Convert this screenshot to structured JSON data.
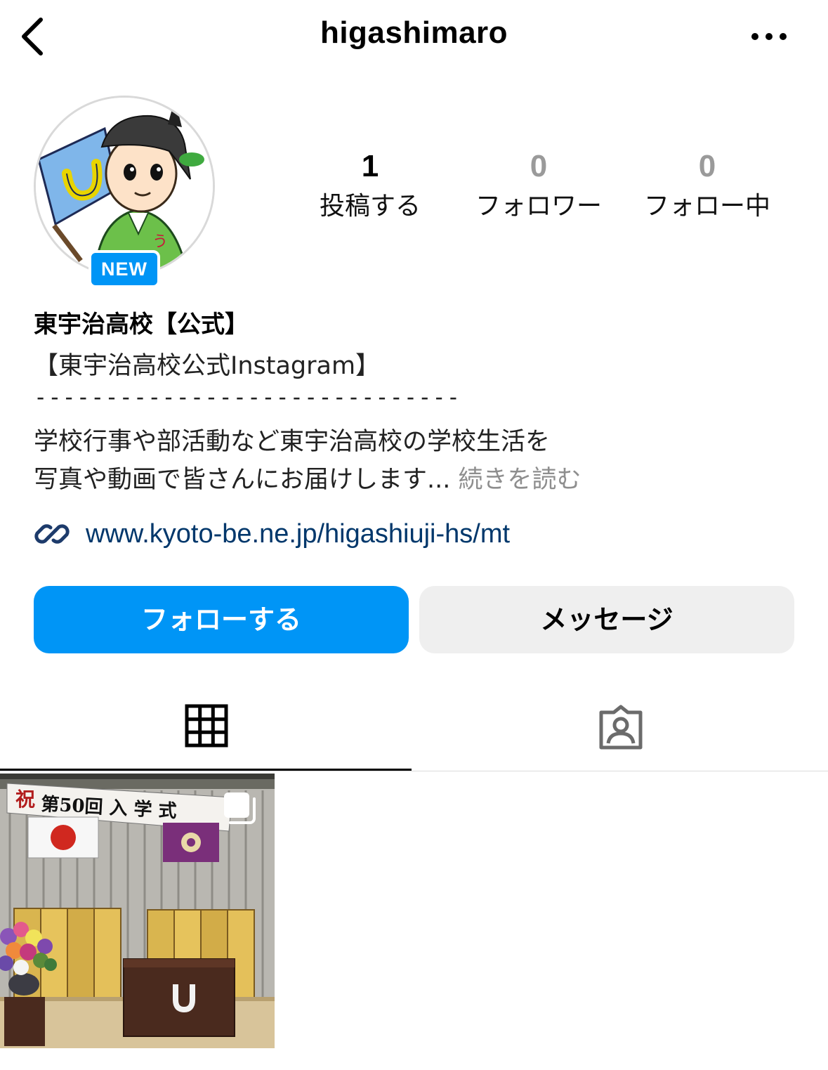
{
  "header": {
    "username": "higashimaro",
    "back_icon": "chevron-left-icon",
    "more_icon": "ellipsis-icon"
  },
  "profile": {
    "avatar_alt": "mascot-illustration",
    "new_badge": "NEW",
    "stats": [
      {
        "value": "1",
        "label": "投稿する"
      },
      {
        "value": "0",
        "label": "フォロワー"
      },
      {
        "value": "0",
        "label": "フォロー中"
      }
    ],
    "display_name": "東宇治高校【公式】",
    "bio": {
      "line1": "【東宇治高校公式Instagram】",
      "line2": "------------------------------",
      "line3": "学校行事や部活動など東宇治高校の学校生活を",
      "line4": "写真や動画で皆さんにお届けします...",
      "more": " 続きを読む"
    },
    "link": "www.kyoto-be.ne.jp/higashiuji-hs/mt"
  },
  "actions": {
    "follow": "フォローする",
    "message": "メッセージ"
  },
  "tabs": {
    "posts_icon": "grid-icon",
    "tagged_icon": "tagged-person-icon",
    "active": "posts"
  },
  "posts": [
    {
      "banner_mark": "祝",
      "banner_text": "第50回 入 学 式",
      "multi_icon": "carousel-icon"
    }
  ],
  "colors": {
    "accent": "#0095f6",
    "link": "#00376b",
    "muted": "#8e8e8e",
    "secondary_button": "#efefef"
  }
}
